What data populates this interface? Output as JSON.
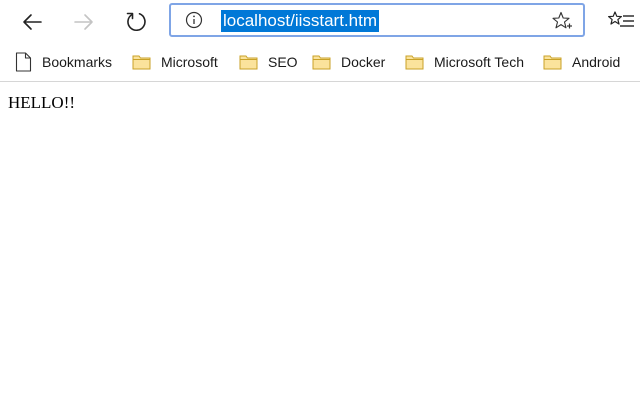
{
  "browser": {
    "address": {
      "url": "localhost/iisstart.htm"
    },
    "icons": {
      "back": "back-arrow-icon",
      "forward": "forward-arrow-icon",
      "refresh": "refresh-icon",
      "info": "info-icon",
      "favorite": "star-icon",
      "favorites_list": "favorites-list-icon"
    },
    "colors": {
      "url_highlight": "#0078d7",
      "address_border": "#7fa5e6",
      "folder_fill": "#fbe39c",
      "folder_stroke": "#c9a227"
    }
  },
  "bookmarks": {
    "items": [
      {
        "label": "Bookmarks",
        "icon": "page-icon"
      },
      {
        "label": "Microsoft",
        "icon": "folder-icon"
      },
      {
        "label": "SEO",
        "icon": "folder-icon"
      },
      {
        "label": "Docker",
        "icon": "folder-icon"
      },
      {
        "label": "Microsoft Tech",
        "icon": "folder-icon"
      },
      {
        "label": "Android",
        "icon": "folder-icon"
      }
    ]
  },
  "page": {
    "text": "HELLO!!"
  }
}
